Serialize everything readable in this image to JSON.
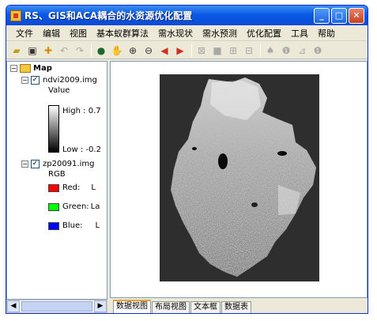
{
  "window": {
    "title": "RS、GIS和ACA耦合的水资源优化配置"
  },
  "menu": [
    "文件",
    "编辑",
    "视图",
    "基本蚁群算法",
    "需水现状",
    "需水预测",
    "优化配置",
    "工具",
    "帮助"
  ],
  "toc": {
    "root_label": "Map",
    "layer1": {
      "name": "ndvi2009.img",
      "field": "Value",
      "high": "High : 0.7",
      "low": "Low : -0.2"
    },
    "layer2": {
      "name": "zp20091.img",
      "field": "RGB",
      "bands": [
        {
          "label": "Red:",
          "value": "L",
          "color": "#ff0000"
        },
        {
          "label": "Green:",
          "value": "La",
          "color": "#00ff00"
        },
        {
          "label": "Blue:",
          "value": "L",
          "color": "#0000ff"
        }
      ]
    }
  },
  "tabs": [
    "数据视图",
    "布局视图",
    "文本框",
    "数据表"
  ],
  "toolbar_icons": [
    "open-folder-icon",
    "save-icon",
    "add-data-icon",
    "undo-icon",
    "redo-icon",
    "globe-icon",
    "pan-icon",
    "zoom-in-icon",
    "zoom-out-icon",
    "back-icon",
    "forward-icon",
    "full-extent-icon",
    "stop-icon",
    "identify-icon",
    "select-icon",
    "find-icon",
    "info-icon",
    "measure-icon",
    "help-icon"
  ]
}
